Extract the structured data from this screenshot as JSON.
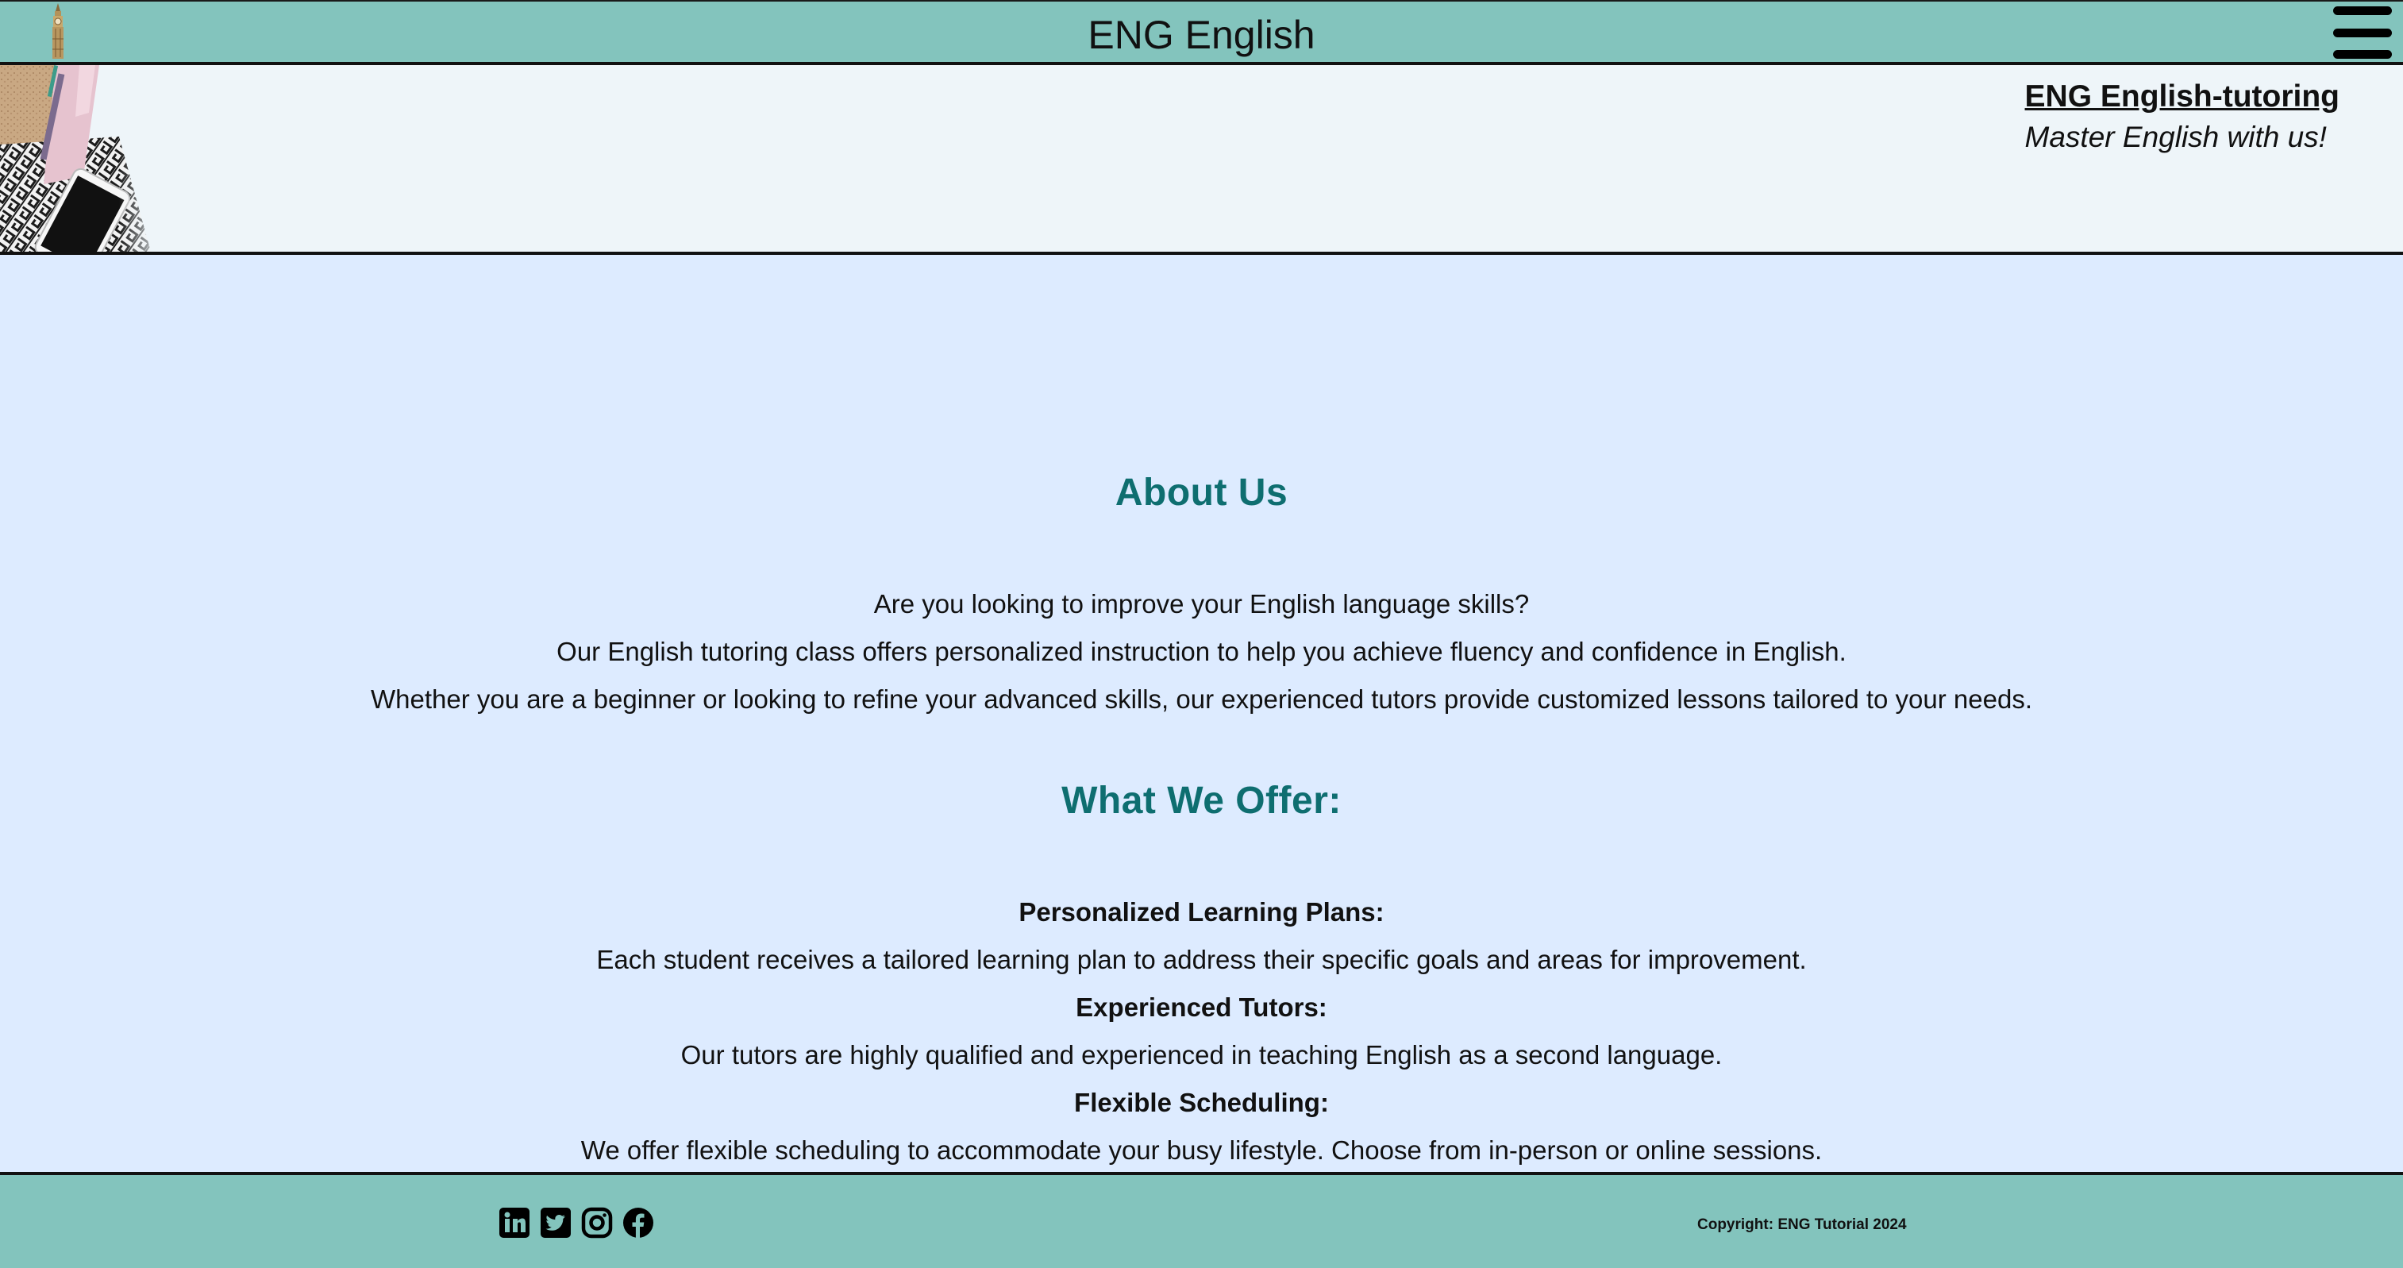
{
  "header": {
    "site_title": "ENG English",
    "logo_icon": "big-ben-tower-icon",
    "menu_icon": "hamburger-menu-icon"
  },
  "hero": {
    "brand_link": "ENG English-tutoring",
    "tagline": "Master English with us!"
  },
  "about": {
    "heading": "About Us",
    "lines": [
      "Are you looking to improve your English language skills?",
      "Our English tutoring class offers personalized instruction to help you achieve fluency and confidence in English.",
      "Whether you are a beginner or looking to refine your advanced skills, our experienced tutors provide customized lessons tailored to your needs."
    ]
  },
  "offer": {
    "heading": "What We Offer:",
    "items": [
      {
        "title": "Personalized Learning Plans:",
        "text": "Each student receives a tailored learning plan to address their specific goals and areas for improvement."
      },
      {
        "title": "Experienced Tutors:",
        "text": "Our tutors are highly qualified and experienced in teaching English as a second language."
      },
      {
        "title": "Flexible Scheduling:",
        "text": "We offer flexible scheduling to accommodate your busy lifestyle. Choose from in-person or online sessions."
      }
    ]
  },
  "footer": {
    "social_icons": [
      "linkedin-icon",
      "twitter-icon",
      "instagram-icon",
      "facebook-icon"
    ],
    "copyright": "Copyright: ENG Tutorial 2024"
  },
  "colors": {
    "header_bg": "#83c4bd",
    "hero_bg": "#eef5f9",
    "page_bg": "#ddebff",
    "heading": "#0e6e70"
  }
}
